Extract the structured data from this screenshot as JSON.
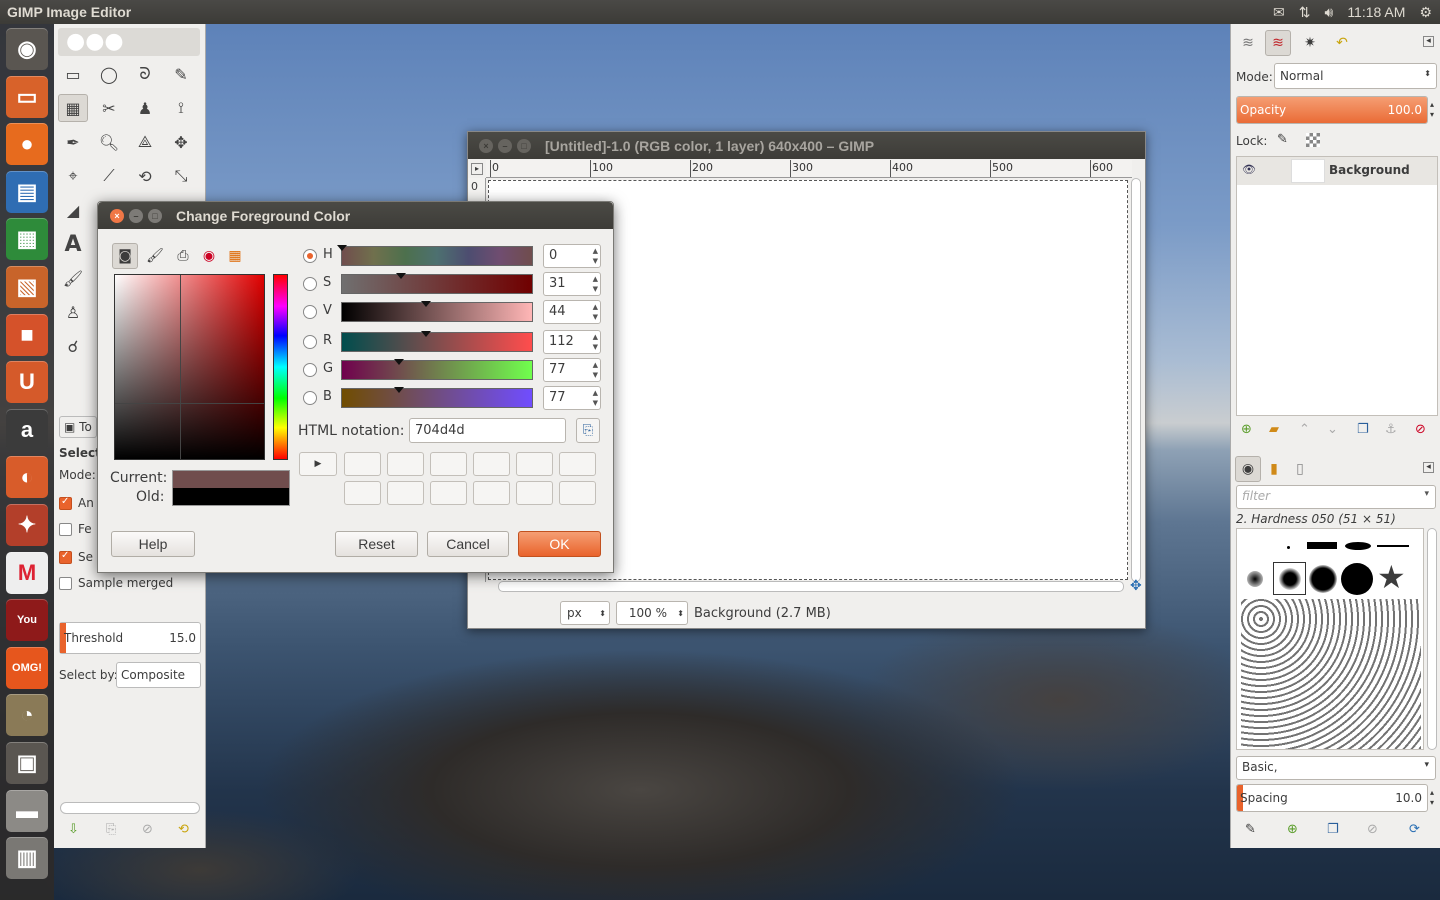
{
  "top_panel": {
    "app_title": "GIMP Image Editor",
    "time": "11:18 AM",
    "indicator_icons": [
      "mail-icon",
      "network-icon",
      "volume-icon",
      "gear-icon"
    ]
  },
  "launcher": {
    "items": [
      {
        "name": "ubuntu-home",
        "glyph": "◉",
        "color": "#5a5651"
      },
      {
        "name": "files",
        "glyph": "▭",
        "color": "#d8622a"
      },
      {
        "name": "firefox",
        "glyph": "●",
        "color": "#e76b1e"
      },
      {
        "name": "writer",
        "glyph": "▤",
        "color": "#2f6db3"
      },
      {
        "name": "calc",
        "glyph": "▦",
        "color": "#2e8b3a"
      },
      {
        "name": "impress",
        "glyph": "▧",
        "color": "#c8642a"
      },
      {
        "name": "software-center",
        "glyph": "■",
        "color": "#d5522a"
      },
      {
        "name": "ubuntu-one",
        "glyph": "U",
        "color": "#d55a2a"
      },
      {
        "name": "amazon",
        "glyph": "a",
        "color": "#3b3b3b"
      },
      {
        "name": "ubuntu-one-music",
        "glyph": "◐",
        "color": "#d85c2a"
      },
      {
        "name": "system-settings",
        "glyph": "✦",
        "color": "#b33f2a"
      },
      {
        "name": "gmail",
        "glyph": "M",
        "color": "#eeeeee"
      },
      {
        "name": "youtube",
        "glyph": "You",
        "color": "#8e1a1a"
      },
      {
        "name": "omg-ubuntu",
        "glyph": "OMG!",
        "color": "#e6561d"
      },
      {
        "name": "gimp",
        "glyph": "◔",
        "color": "#8a7a57"
      },
      {
        "name": "workspaces",
        "glyph": "▣",
        "color": "#5a5651"
      },
      {
        "name": "drive",
        "glyph": "▬",
        "color": "#8c8a86"
      },
      {
        "name": "trash",
        "glyph": "▥",
        "color": "#7a7874"
      }
    ]
  },
  "toolbox": {
    "tool_options": {
      "tab_label": "To",
      "title": "Select",
      "mode_label": "Mode:",
      "antialias": "An",
      "feather": "Fe",
      "select_transparent": "Se",
      "sample_merged": "Sample merged",
      "threshold_label": "Threshold",
      "threshold_value": "15.0",
      "select_by_label": "Select by:",
      "select_by_value": "Composite"
    }
  },
  "image_window": {
    "title": "[Untitled]-1.0 (RGB color, 1 layer) 640x400 – GIMP",
    "ruler_marks": [
      "0",
      "100",
      "200",
      "300",
      "400",
      "500",
      "600"
    ],
    "ruler_v_zero": "0",
    "unit": "px",
    "zoom": "100 %",
    "status": "Background (2.7 MB)"
  },
  "color_dialog": {
    "title": "Change Foreground Color",
    "channels": [
      {
        "label": "H",
        "value": "0",
        "level": 0.0,
        "checked": true
      },
      {
        "label": "S",
        "value": "31",
        "level": 0.31,
        "checked": false
      },
      {
        "label": "V",
        "value": "44",
        "level": 0.44,
        "checked": false
      },
      {
        "label": "R",
        "value": "112",
        "level": 0.44,
        "checked": false
      },
      {
        "label": "G",
        "value": "77",
        "level": 0.3,
        "checked": false
      },
      {
        "label": "B",
        "value": "77",
        "level": 0.3,
        "checked": false
      }
    ],
    "html_notation_label": "HTML notation:",
    "html_notation_value": "704d4d",
    "current_label": "Current:",
    "old_label": "Old:",
    "current_color": "#704d4d",
    "old_color": "#000000",
    "buttons": {
      "help": "Help",
      "reset": "Reset",
      "cancel": "Cancel",
      "ok": "OK"
    }
  },
  "right_dock": {
    "mode_label": "Mode:",
    "mode_value": "Normal",
    "opacity_label": "Opacity",
    "opacity_value": "100.0",
    "lock_label": "Lock:",
    "layer_name": "Background",
    "brush_filter_placeholder": "filter",
    "brush_name": "2. Hardness 050 (51 × 51)",
    "brush_tag": "Basic,",
    "spacing_label": "Spacing",
    "spacing_value": "10.0"
  },
  "colors": {
    "accent": "#e9632c",
    "panel": "#3c3b37"
  }
}
